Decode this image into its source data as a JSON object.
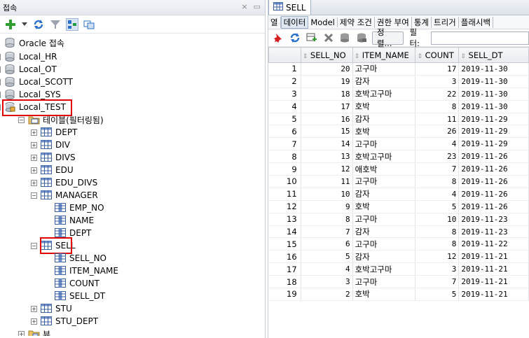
{
  "left": {
    "header_title": "접속",
    "header_ctrls": [
      "×",
      "▭"
    ],
    "toolbar": [
      "add-icon",
      "dropdown-icon",
      "refresh-icon",
      "filter-icon",
      "schema-browser-icon",
      "new-connection-icon"
    ],
    "tree": [
      {
        "label": "Oracle 접속",
        "icon": "oracle-connections-icon"
      },
      {
        "label": "Local_HR",
        "icon": "database-icon",
        "exp": "+"
      },
      {
        "label": "Local_OT",
        "icon": "database-icon",
        "exp": "+"
      },
      {
        "label": "Local_SCOTT",
        "icon": "database-icon",
        "exp": "+"
      },
      {
        "label": "Local_SYS",
        "icon": "database-icon",
        "exp": "+"
      },
      {
        "label": "Local_TEST",
        "icon": "database-open-icon",
        "exp": "−"
      },
      {
        "label": "테이블(필터링됨)",
        "icon": "folder-icon",
        "exp": "−"
      },
      {
        "label": "DEPT",
        "icon": "table-icon",
        "exp": "+"
      },
      {
        "label": "DIV",
        "icon": "table-icon",
        "exp": "+"
      },
      {
        "label": "DIVS",
        "icon": "table-icon",
        "exp": "+"
      },
      {
        "label": "EDU",
        "icon": "table-icon",
        "exp": "+"
      },
      {
        "label": "EDU_DIVS",
        "icon": "table-icon",
        "exp": "+"
      },
      {
        "label": "MANAGER",
        "icon": "table-icon",
        "exp": "−"
      },
      {
        "label": "EMP_NO",
        "icon": "column-icon"
      },
      {
        "label": "NAME",
        "icon": "column-icon"
      },
      {
        "label": "DEPT",
        "icon": "column-icon"
      },
      {
        "label": "SELL",
        "icon": "table-icon",
        "exp": "−"
      },
      {
        "label": "SELL_NO",
        "icon": "column-icon"
      },
      {
        "label": "ITEM_NAME",
        "icon": "column-icon"
      },
      {
        "label": "COUNT",
        "icon": "column-icon"
      },
      {
        "label": "SELL_DT",
        "icon": "column-icon"
      },
      {
        "label": "STU",
        "icon": "table-icon",
        "exp": "+"
      },
      {
        "label": "STU_DEPT",
        "icon": "table-icon",
        "exp": "+"
      },
      {
        "label": "뷰",
        "icon": "view-folder-icon",
        "exp": "+"
      }
    ]
  },
  "right": {
    "tab_label": "SELL",
    "subtabs": [
      "열",
      "데이터",
      "Model",
      "제약 조건",
      "권한 부여",
      "통계",
      "트리거",
      "플래시백"
    ],
    "active_subtab": "데이터",
    "toolbar_icons": [
      "pin-icon",
      "refresh-icon",
      "insert-row-icon",
      "delete-row-icon",
      "commit-icon",
      "rollback-icon"
    ],
    "sort_label": "정렬...",
    "filter_label": "필터:",
    "filter_value": "",
    "columns": [
      "SELL_NO",
      "ITEM_NAME",
      "COUNT",
      "SELL_DT"
    ],
    "rows": [
      [
        "1",
        "20",
        "고구마",
        "17",
        "2019-11-30"
      ],
      [
        "2",
        "19",
        "감자",
        "3",
        "2019-11-30"
      ],
      [
        "3",
        "18",
        "호박고구마",
        "22",
        "2019-11-30"
      ],
      [
        "4",
        "17",
        "호박",
        "8",
        "2019-11-30"
      ],
      [
        "5",
        "16",
        "감자",
        "11",
        "2019-11-29"
      ],
      [
        "6",
        "15",
        "호박",
        "26",
        "2019-11-29"
      ],
      [
        "7",
        "14",
        "고구마",
        "4",
        "2019-11-29"
      ],
      [
        "8",
        "13",
        "호박고구마",
        "23",
        "2019-11-26"
      ],
      [
        "9",
        "12",
        "애호박",
        "7",
        "2019-11-26"
      ],
      [
        "10",
        "11",
        "고구마",
        "8",
        "2019-11-26"
      ],
      [
        "11",
        "10",
        "감자",
        "4",
        "2019-11-26"
      ],
      [
        "12",
        "9",
        "호박",
        "5",
        "2019-11-26"
      ],
      [
        "13",
        "8",
        "고구마",
        "10",
        "2019-11-23"
      ],
      [
        "14",
        "7",
        "감자",
        "8",
        "2019-11-23"
      ],
      [
        "15",
        "6",
        "고구마",
        "8",
        "2019-11-22"
      ],
      [
        "16",
        "5",
        "감자",
        "12",
        "2019-11-21"
      ],
      [
        "17",
        "4",
        "호박고구마",
        "3",
        "2019-11-21"
      ],
      [
        "18",
        "3",
        "고구마",
        "7",
        "2019-11-21"
      ],
      [
        "19",
        "2",
        "호박",
        "5",
        "2019-11-21"
      ]
    ]
  }
}
